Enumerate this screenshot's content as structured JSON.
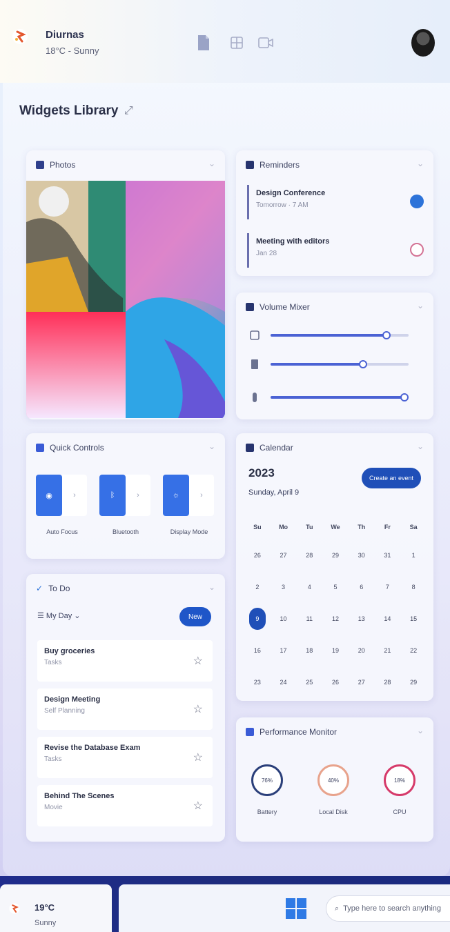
{
  "header": {
    "weather_title": "Diurnas",
    "weather_sub": "18°C - Sunny",
    "tabs": [
      "document-icon",
      "grid-icon",
      "video-icon"
    ]
  },
  "library": {
    "title": "Widgets Library",
    "edit_icon": "expand-icon"
  },
  "photos": {
    "title": "Photos"
  },
  "reminders": {
    "title": "Reminders",
    "items": [
      {
        "title": "Design Conference",
        "sub": "Tomorrow · 7 AM",
        "done": true
      },
      {
        "title": "Meeting with editors",
        "sub": "Jan 28",
        "done": false
      }
    ]
  },
  "volume": {
    "title": "Volume Mixer",
    "rows": [
      {
        "icon": "speaker-icon",
        "level": 0.84
      },
      {
        "icon": "app-icon",
        "level": 0.67
      },
      {
        "icon": "mic-icon",
        "level": 0.97
      }
    ]
  },
  "quick_controls": {
    "title": "Quick Controls",
    "items": [
      {
        "label": "Auto Focus"
      },
      {
        "label": "Bluetooth"
      },
      {
        "label": "Display Mode"
      }
    ]
  },
  "todo": {
    "title": "To Do",
    "list": "My Day",
    "new_label": "New",
    "items": [
      {
        "title": "Buy groceries",
        "sub": "Tasks"
      },
      {
        "title": "Design Meeting",
        "sub": "Self Planning"
      },
      {
        "title": "Revise the Database Exam",
        "sub": "Tasks"
      },
      {
        "title": "Behind The Scenes",
        "sub": "Movie"
      }
    ]
  },
  "calendar": {
    "title": "Calendar",
    "year": "2023",
    "date": "Sunday, April 9",
    "button": "Create an event",
    "week_header": [
      "Su",
      "Mo",
      "Tu",
      "We",
      "Th",
      "Fr",
      "Sa"
    ],
    "weeks": [
      [
        "26",
        "27",
        "28",
        "29",
        "30",
        "31",
        "1"
      ],
      [
        "2",
        "3",
        "4",
        "5",
        "6",
        "7",
        "8"
      ],
      [
        "9",
        "10",
        "11",
        "12",
        "13",
        "14",
        "15"
      ],
      [
        "16",
        "17",
        "18",
        "19",
        "20",
        "21",
        "22"
      ],
      [
        "23",
        "24",
        "25",
        "26",
        "27",
        "28",
        "29"
      ]
    ],
    "selected": "9"
  },
  "performance": {
    "title": "Performance Monitor",
    "items": [
      {
        "label": "Battery",
        "value": "76%",
        "color": "#2a3f7a"
      },
      {
        "label": "Local Disk",
        "value": "40%",
        "color": "#e8a38c"
      },
      {
        "label": "CPU",
        "value": "18%",
        "color": "#d63a6a"
      }
    ]
  },
  "taskbar": {
    "weather_temp": "19°C",
    "weather_cond": "Sunny",
    "search_placeholder": "Type here to search anything"
  }
}
